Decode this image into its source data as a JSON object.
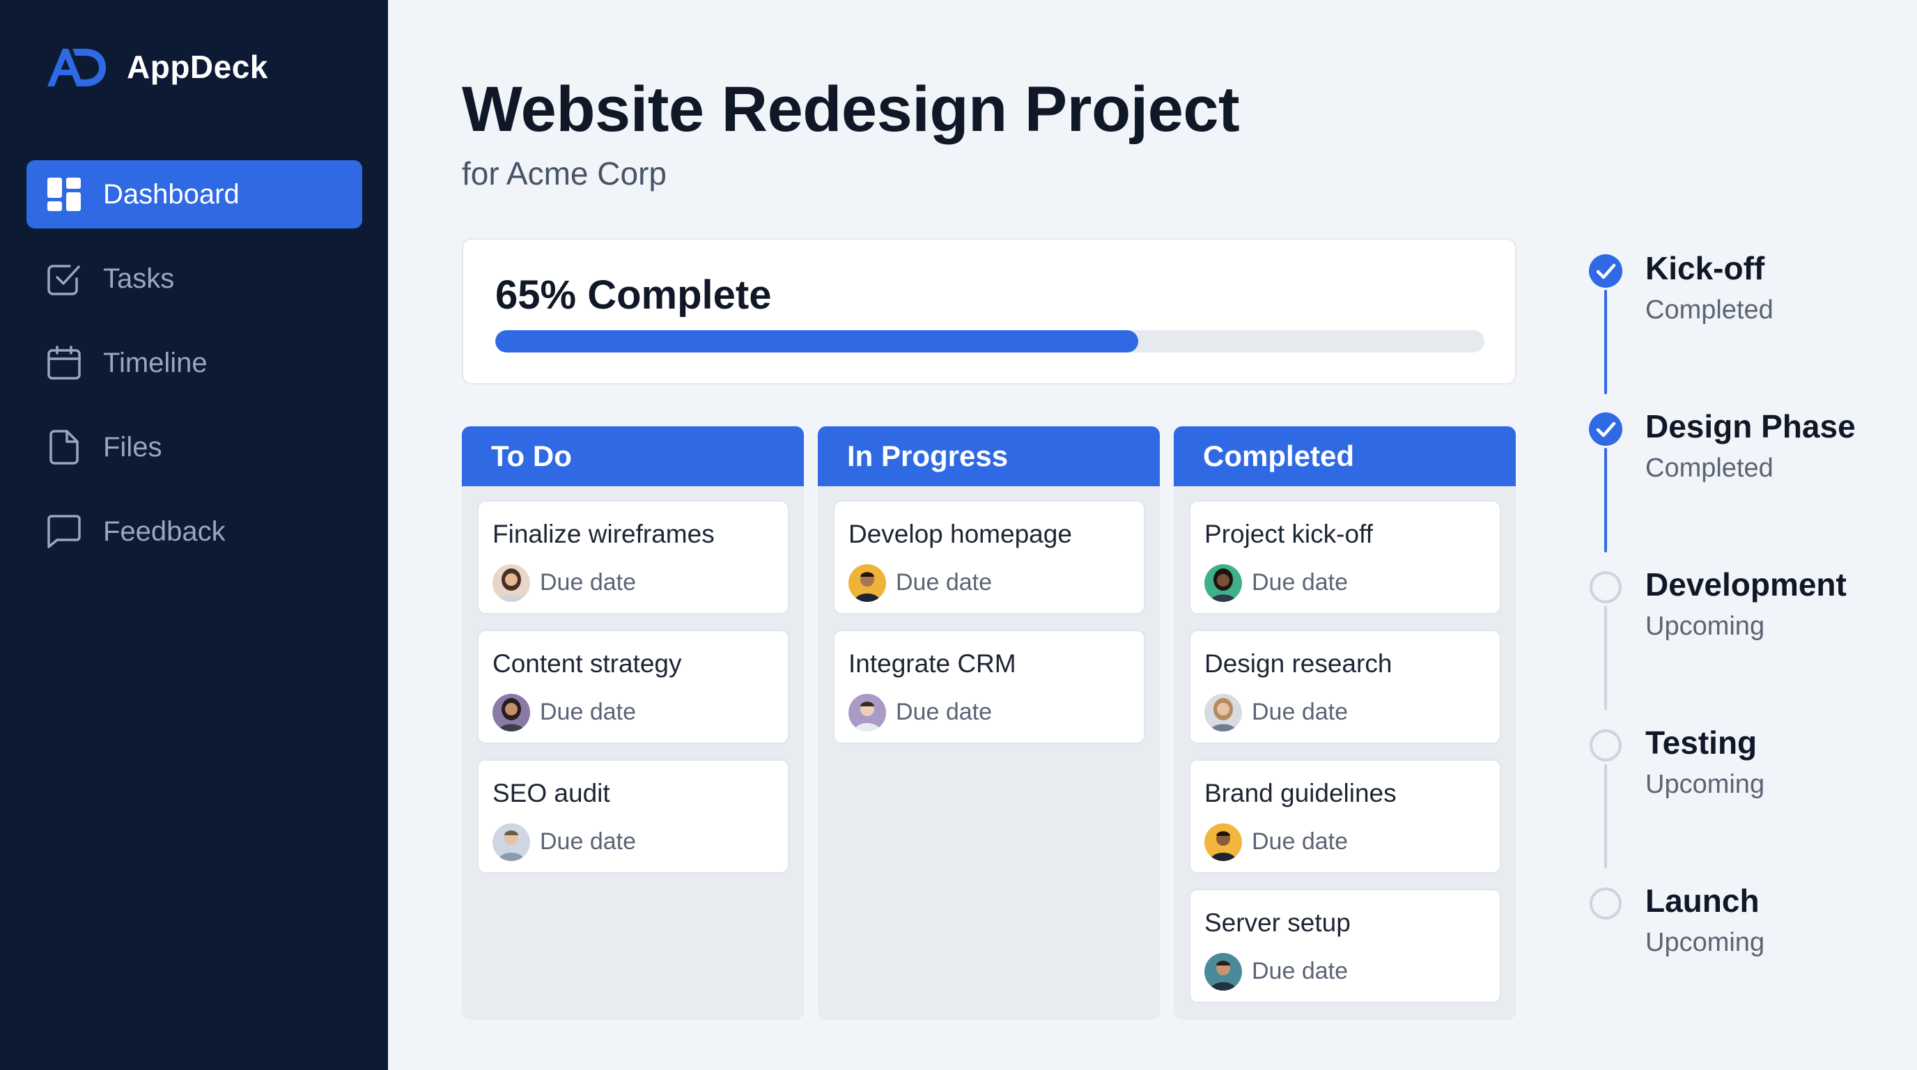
{
  "brand": {
    "name": "AppDeck"
  },
  "nav": {
    "items": [
      {
        "label": "Dashboard",
        "icon": "dashboard-icon",
        "active": true
      },
      {
        "label": "Tasks",
        "icon": "checkbox-icon",
        "active": false
      },
      {
        "label": "Timeline",
        "icon": "calendar-icon",
        "active": false
      },
      {
        "label": "Files",
        "icon": "file-icon",
        "active": false
      },
      {
        "label": "Feedback",
        "icon": "chat-icon",
        "active": false
      }
    ]
  },
  "header": {
    "title": "Website Redesign Project",
    "subtitle": "for Acme Corp"
  },
  "progress": {
    "label": "65% Complete",
    "percent": 65
  },
  "board": {
    "columns": [
      {
        "title": "To Do",
        "cards": [
          {
            "title": "Finalize wireframes",
            "due": "Due date"
          },
          {
            "title": "Content strategy",
            "due": "Due date"
          },
          {
            "title": "SEO audit",
            "due": "Due date"
          }
        ]
      },
      {
        "title": "In Progress",
        "cards": [
          {
            "title": "Develop homepage",
            "due": "Due date"
          },
          {
            "title": "Integrate CRM",
            "due": "Due date"
          }
        ]
      },
      {
        "title": "Completed",
        "cards": [
          {
            "title": "Project kick-off",
            "due": "Due date"
          },
          {
            "title": "Design research",
            "due": "Due date"
          },
          {
            "title": "Brand guidelines",
            "due": "Due date"
          },
          {
            "title": "Server setup",
            "due": "Due date"
          }
        ]
      }
    ]
  },
  "milestones": [
    {
      "title": "Kick-off",
      "status": "Completed",
      "done": true
    },
    {
      "title": "Design Phase",
      "status": "Completed",
      "done": true
    },
    {
      "title": "Development",
      "status": "Upcoming",
      "done": false
    },
    {
      "title": "Testing",
      "status": "Upcoming",
      "done": false
    },
    {
      "title": "Launch",
      "status": "Upcoming",
      "done": false
    }
  ],
  "colors": {
    "accent": "#2f6ae4",
    "sidebar": "#0d1a33",
    "background": "#f1f4f8"
  }
}
